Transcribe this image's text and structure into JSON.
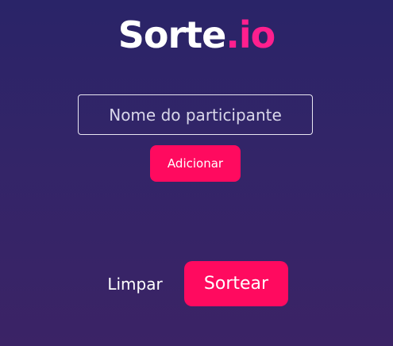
{
  "logo": {
    "brand": "Sorte",
    "tld": ".io"
  },
  "participant_form": {
    "placeholder": "Nome do participante",
    "value": "",
    "add_label": "Adicionar"
  },
  "actions": {
    "clear_label": "Limpar",
    "draw_label": "Sortear"
  },
  "colors": {
    "accent": "#ff0a5f",
    "logo_accent": "#ff1f8e",
    "background_top": "#2a2468",
    "background_bottom": "#3b2366"
  }
}
